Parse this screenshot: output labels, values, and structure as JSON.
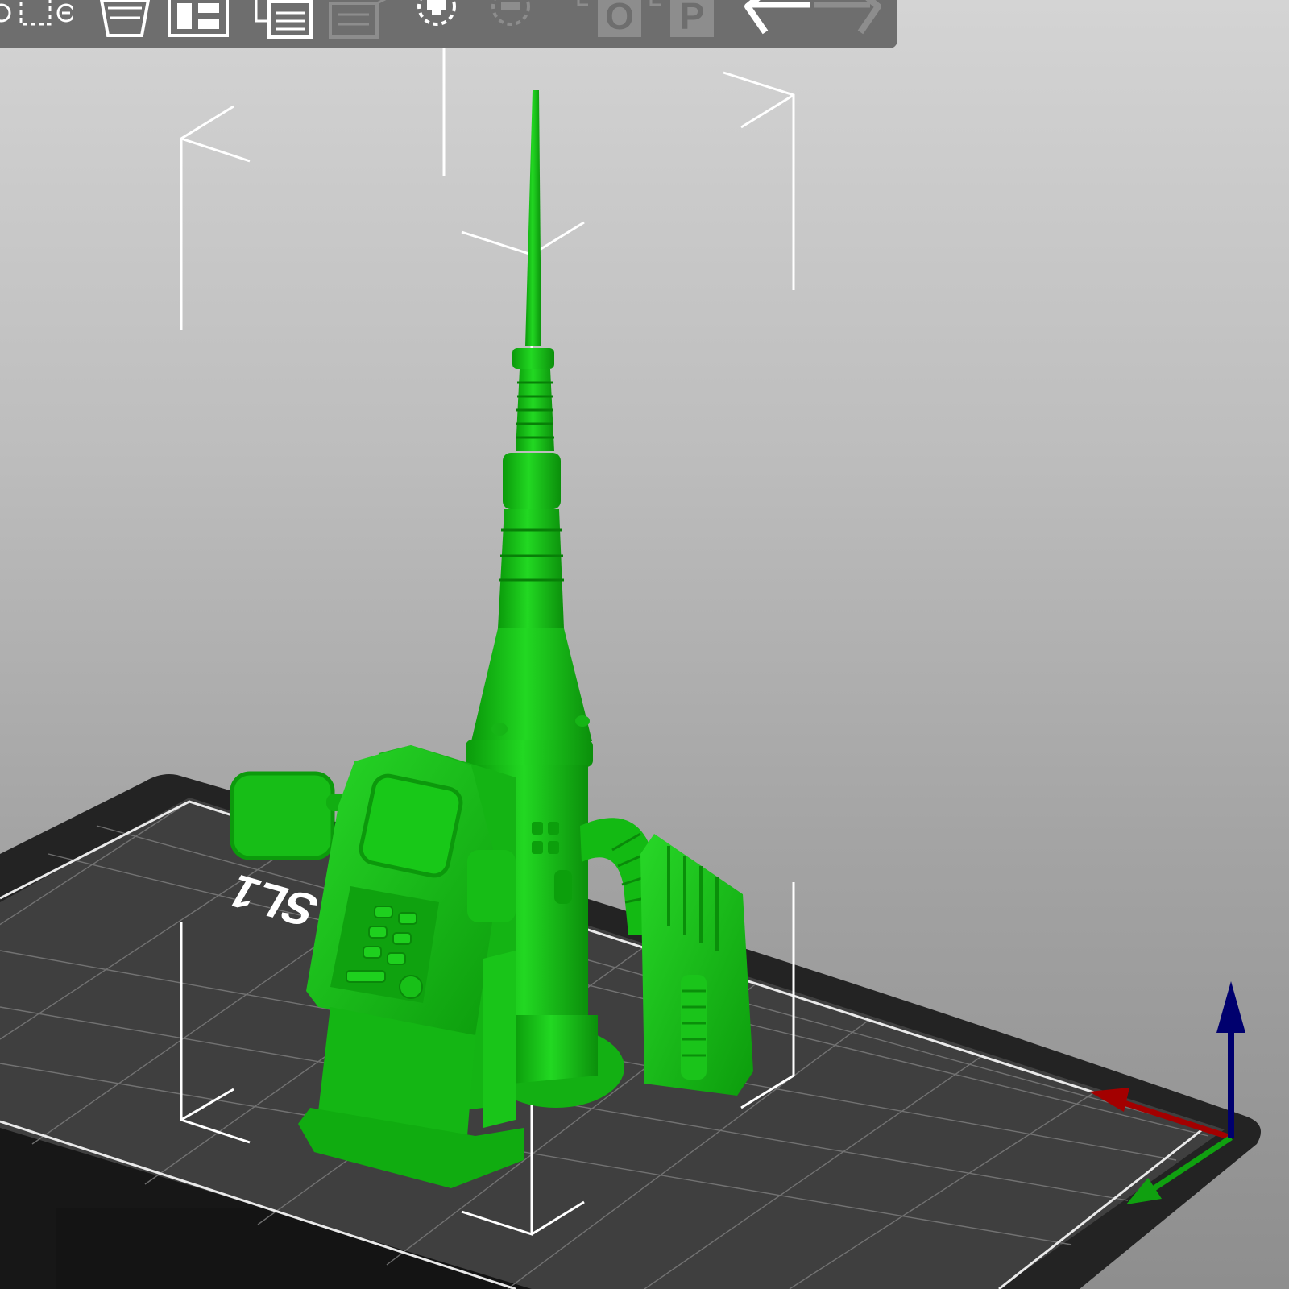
{
  "window": {
    "view": "3D"
  },
  "toolbar": {
    "buttons": [
      {
        "id": "add",
        "icon": "add-object-icon",
        "enabled": true
      },
      {
        "id": "remove",
        "icon": "remove-object-icon",
        "enabled": true
      },
      {
        "id": "delete_all",
        "icon": "delete-all-icon",
        "enabled": true
      },
      {
        "id": "arrange",
        "icon": "arrange-icon",
        "enabled": true
      },
      {
        "id": "copy",
        "icon": "copy-icon",
        "enabled": true
      },
      {
        "id": "paste",
        "icon": "paste-icon",
        "enabled": false
      },
      {
        "id": "add_instance",
        "icon": "add-instance-icon",
        "enabled": true
      },
      {
        "id": "remove_instance",
        "icon": "remove-instance-icon",
        "enabled": false
      },
      {
        "id": "split_objects",
        "icon": "split-objects-icon",
        "label": "O",
        "enabled": false
      },
      {
        "id": "split_parts",
        "icon": "split-parts-icon",
        "label": "P",
        "enabled": false
      },
      {
        "id": "undo",
        "icon": "undo-icon",
        "enabled": true
      },
      {
        "id": "redo",
        "icon": "redo-icon",
        "enabled": false
      }
    ]
  },
  "bed": {
    "label": "SL1",
    "color": "#3a3a3a",
    "grid_color": "#8a8a8a"
  },
  "model": {
    "color": "#11c411",
    "selected": true
  },
  "axes": {
    "x_color": "#a30000",
    "y_color": "#10a010",
    "z_color": "#00006e"
  }
}
